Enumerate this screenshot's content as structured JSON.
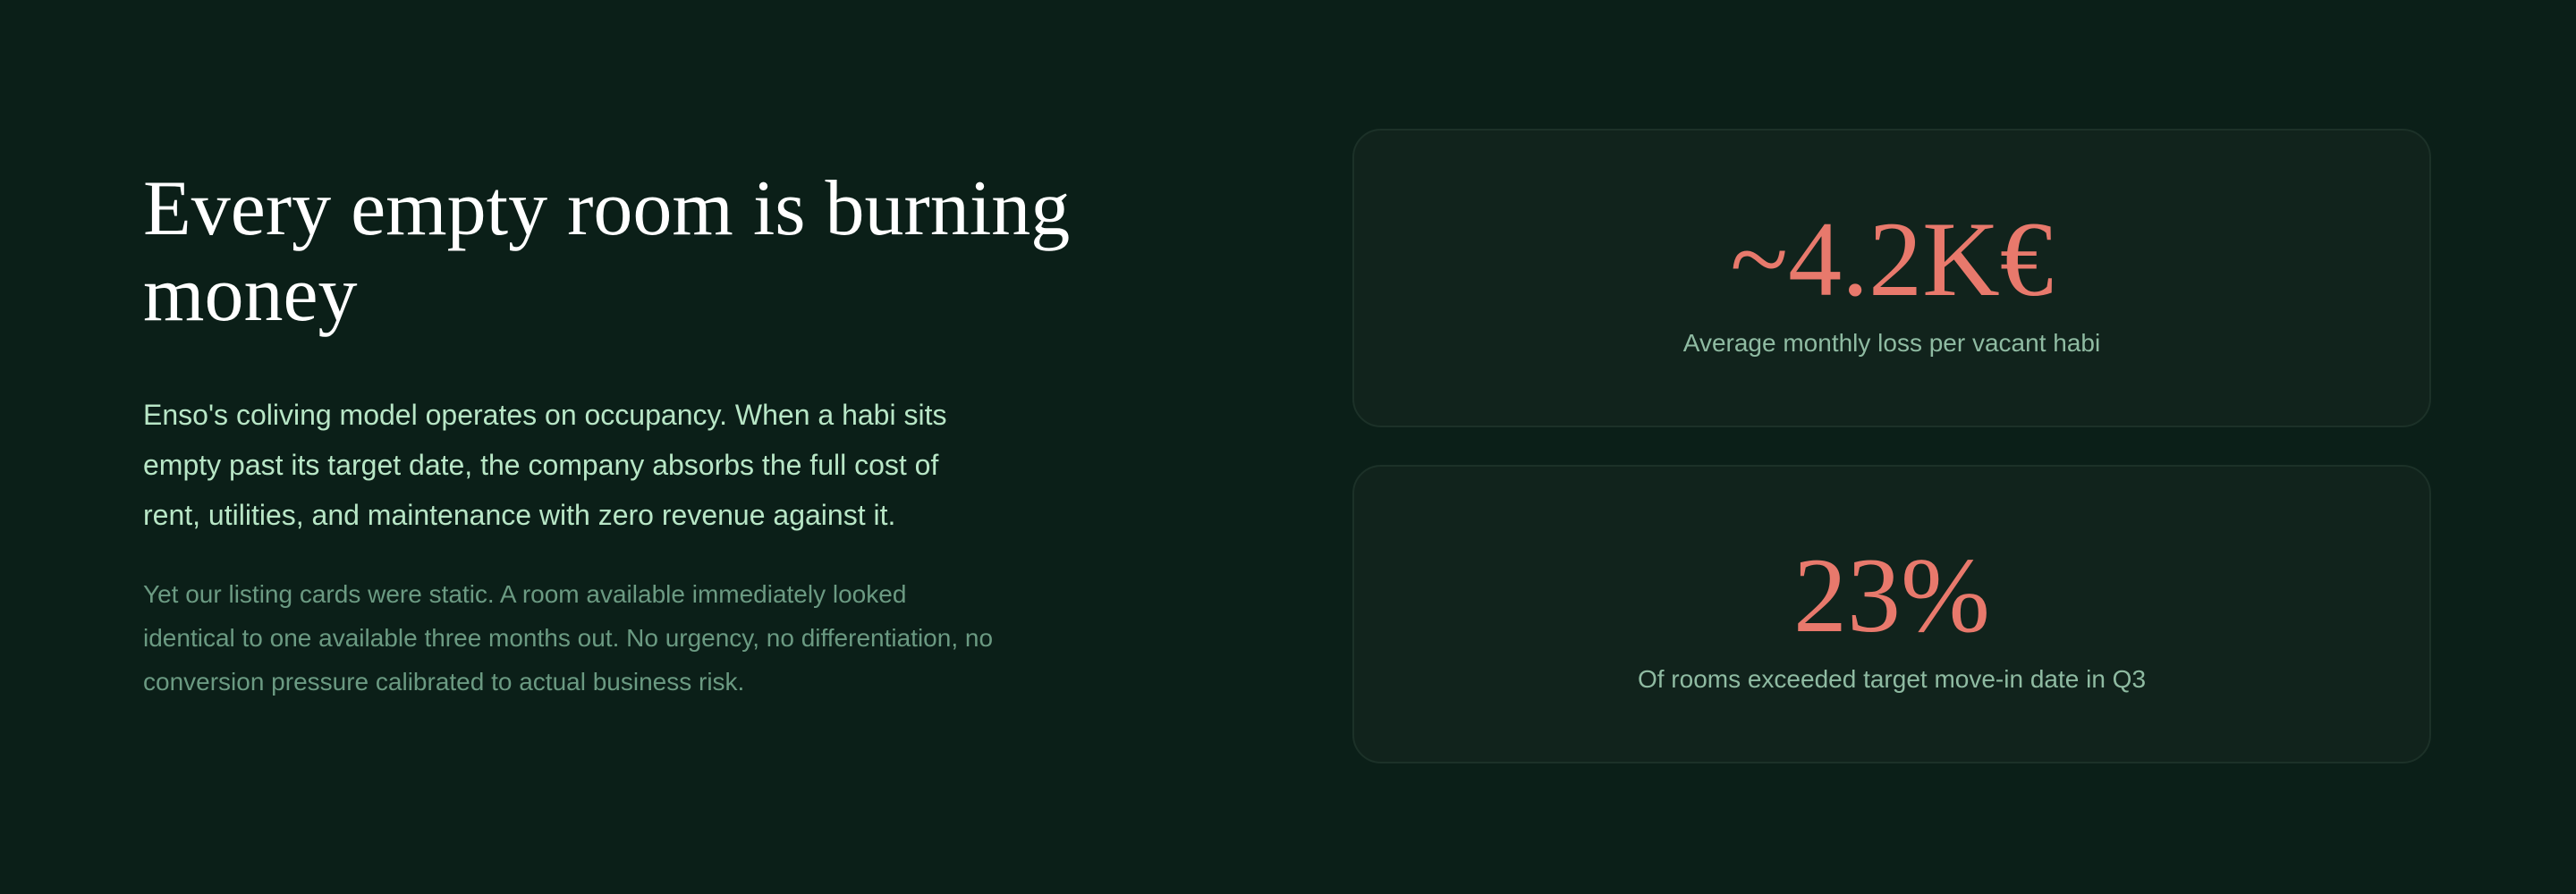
{
  "intro": {
    "headline": "Every empty room is burning money",
    "lead": "Enso's coliving model operates on occupancy. When a habi sits empty past its target date, the company absorbs the full cost of rent, utilities, and maintenance with zero revenue against it.",
    "secondary": "Yet our listing cards were static. A room available immediately looked identical to one available three months out. No urgency, no differentiation, no conversion pressure calibrated to actual business risk."
  },
  "stats": [
    {
      "value": "~4.2K€",
      "label": "Average monthly loss per vacant habi"
    },
    {
      "value": "23%",
      "label": "Of rooms exceeded target move-in date in Q3"
    }
  ],
  "colors": {
    "background": "#0b1f18",
    "card_background": "#11231c",
    "accent": "#e8796c",
    "lead_text": "#b8e6c6",
    "muted_text": "#6b9a82"
  }
}
